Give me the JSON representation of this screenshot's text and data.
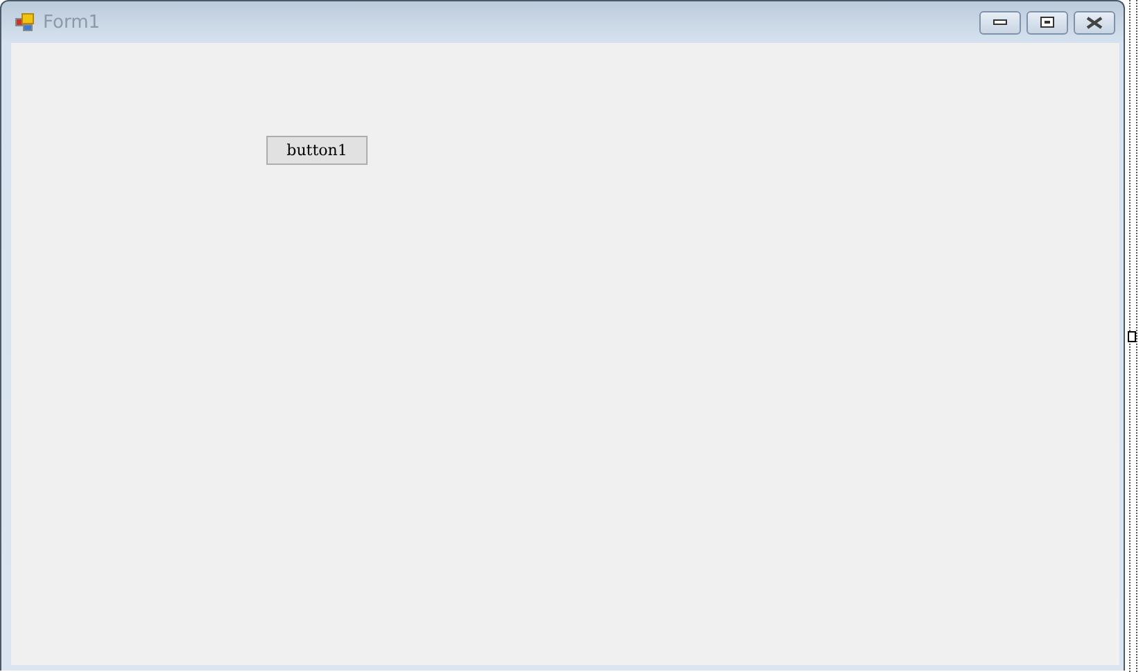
{
  "window": {
    "title": "Form1"
  },
  "form": {
    "controls": [
      {
        "kind": "button",
        "label": "button1"
      }
    ]
  }
}
